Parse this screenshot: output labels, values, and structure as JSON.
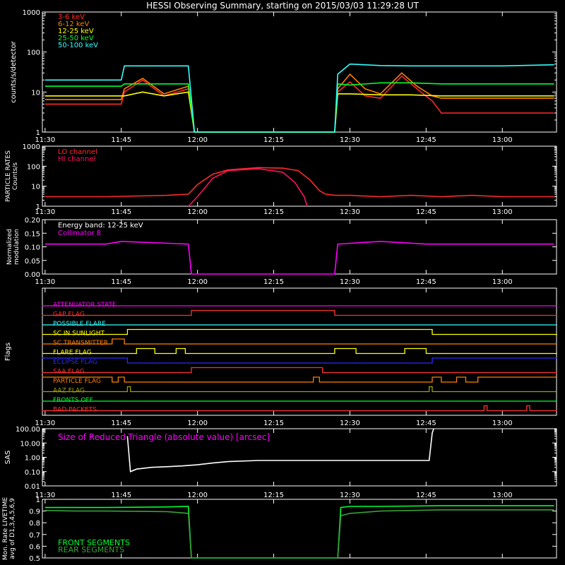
{
  "title": "HESSI Observing Summary, starting on 2015/03/03 11:29:28 UT",
  "time_ticks": [
    "11:30",
    "11:45",
    "12:00",
    "12:15",
    "12:30",
    "12:45",
    "13:00"
  ],
  "colors": {
    "bg": "#000000",
    "axis": "#ffffff",
    "red": "#ff2a2a",
    "orange": "#ff7f00",
    "yellow": "#ffff00",
    "green": "#00ff30",
    "cyan": "#33ffff",
    "magenta": "#ff00ff",
    "flag_red": "#ff3030",
    "flag_blue": "#2a2aff",
    "flag_olive": "#a0a000",
    "gray_green": "#3aa03a",
    "white": "#ffffff"
  },
  "chart_data": [
    {
      "id": "count-rates",
      "type": "line",
      "ylabel": "counts/s/detector",
      "yscale": "log",
      "ylim": [
        1,
        1000
      ],
      "yticks": [
        "1",
        "10",
        "100",
        "1000"
      ],
      "xlim": [
        11.4911,
        13.1778
      ],
      "series": [
        {
          "name": "3-6 keV",
          "color": "#ff2a2a",
          "x": [
            11.5,
            11.75,
            11.76,
            11.82,
            11.89,
            11.97,
            11.99,
            12.45,
            12.46,
            12.5,
            12.55,
            12.6,
            12.67,
            12.72,
            12.77,
            12.8,
            13.0,
            13.17
          ],
          "y": [
            5,
            5,
            10,
            20,
            8,
            12,
            1,
            1,
            10,
            18,
            8,
            7,
            25,
            12,
            6,
            3,
            3,
            3
          ]
        },
        {
          "name": "6-12 keV",
          "color": "#ff7f00",
          "x": [
            11.5,
            11.75,
            11.76,
            11.82,
            11.89,
            11.97,
            11.99,
            12.45,
            12.46,
            12.5,
            12.55,
            12.6,
            12.67,
            12.72,
            12.77,
            12.8,
            13.0,
            13.17
          ],
          "y": [
            6.5,
            6.5,
            12,
            22,
            9,
            14,
            1,
            1,
            12,
            28,
            12,
            9,
            30,
            14,
            8,
            7,
            7,
            7
          ]
        },
        {
          "name": "12-25 keV",
          "color": "#ffff00",
          "x": [
            11.5,
            11.75,
            11.76,
            11.82,
            11.89,
            11.97,
            11.99,
            12.45,
            12.46,
            12.5,
            12.6,
            12.7,
            12.8,
            13.0,
            13.17
          ],
          "y": [
            8,
            8,
            8,
            10,
            8,
            10,
            1,
            1,
            9,
            9,
            8.5,
            8.5,
            8,
            8,
            8
          ]
        },
        {
          "name": "25-50 keV",
          "color": "#00ff30",
          "x": [
            11.5,
            11.75,
            11.76,
            11.97,
            11.99,
            12.45,
            12.46,
            12.5,
            12.6,
            12.7,
            12.8,
            13.0,
            13.17
          ],
          "y": [
            14,
            14,
            16,
            16,
            1,
            1,
            16,
            15,
            17,
            17,
            16,
            16,
            16
          ]
        },
        {
          "name": "50-100 keV",
          "color": "#33ffff",
          "x": [
            11.5,
            11.75,
            11.76,
            11.97,
            11.99,
            12.45,
            12.46,
            12.5,
            12.6,
            12.7,
            12.8,
            13.0,
            13.17
          ],
          "y": [
            20,
            20,
            45,
            45,
            1,
            1,
            28,
            50,
            46,
            45,
            45,
            45,
            48
          ]
        }
      ]
    },
    {
      "id": "particle-rates",
      "type": "line",
      "ylabel": "PARTICLE RATES Counts/s",
      "yscale": "log",
      "ylim": [
        1,
        1000
      ],
      "yticks": [
        "1",
        "10",
        "100",
        "1000"
      ],
      "xlim": [
        11.4911,
        13.1778
      ],
      "series": [
        {
          "name": "LO channel",
          "color": "#ff2a2a",
          "x": [
            11.5,
            11.7,
            11.9,
            11.97,
            12.0,
            12.05,
            12.1,
            12.2,
            12.28,
            12.33,
            12.37,
            12.4,
            12.42,
            12.45,
            12.5,
            12.6,
            12.7,
            12.8,
            12.9,
            13.0,
            13.17
          ],
          "y": [
            3,
            3,
            3.5,
            4,
            12,
            40,
            65,
            85,
            80,
            60,
            20,
            6,
            4,
            3.5,
            3.5,
            3,
            3.5,
            3,
            3.5,
            3,
            3
          ]
        },
        {
          "name": "HI channel",
          "color": "#ff1060",
          "x": [
            11.97,
            12.0,
            12.05,
            12.1,
            12.2,
            12.28,
            12.32,
            12.35,
            12.36
          ],
          "y": [
            1,
            3,
            25,
            60,
            75,
            50,
            15,
            3,
            1
          ]
        }
      ]
    },
    {
      "id": "modulation",
      "type": "line",
      "ylabel": "Normalized modulation",
      "ylim": [
        0,
        0.2
      ],
      "yticks": [
        "0.00",
        "0.05",
        "0.10",
        "0.15",
        "0.20"
      ],
      "xlim": [
        11.4911,
        13.1778
      ],
      "annotation": "Energy band: 12-25 keV",
      "series": [
        {
          "name": "Collimator 8",
          "color": "#ff00ff",
          "x": [
            11.5,
            11.7,
            11.75,
            11.97,
            11.98,
            12.45,
            12.46,
            12.6,
            12.75,
            13.0,
            13.17
          ],
          "y": [
            0.11,
            0.11,
            0.12,
            0.11,
            0.0,
            0.0,
            0.11,
            0.12,
            0.11,
            0.11,
            0.11
          ]
        }
      ]
    },
    {
      "id": "flags",
      "type": "line",
      "ylabel": "Flags",
      "xlim": [
        11.4911,
        13.1778
      ],
      "flags": [
        {
          "name": "ATTENUATOR STATE",
          "color": "#ff00ff",
          "x": [
            11.49,
            13.18
          ],
          "y": [
            0,
            0
          ]
        },
        {
          "name": "GAP FLAG",
          "color": "#ff3030",
          "x": [
            11.49,
            11.98,
            11.98,
            12.45,
            12.45,
            13.18
          ],
          "y": [
            0,
            0,
            1,
            1,
            0,
            0
          ]
        },
        {
          "name": "POSSIBLE FLARE",
          "color": "#33ffff",
          "x": [
            11.49,
            13.18
          ],
          "y": [
            0,
            0
          ]
        },
        {
          "name": "SC IN SUNLIGHT",
          "color": "#ffff00",
          "x": [
            11.49,
            11.77,
            11.77,
            12.77,
            12.77,
            13.18
          ],
          "y": [
            0,
            0,
            1,
            1,
            0,
            0
          ]
        },
        {
          "name": "SC TRANSMITTER",
          "color": "#ff7f00",
          "x": [
            11.49,
            11.72,
            11.72,
            11.76,
            11.76,
            13.18
          ],
          "y": [
            0,
            0,
            1,
            1,
            0,
            0
          ]
        },
        {
          "name": "FLARE FLAG",
          "color": "#ffff00",
          "x": [
            11.49,
            11.8,
            11.8,
            11.86,
            11.86,
            11.93,
            11.93,
            11.96,
            11.96,
            12.45,
            12.45,
            12.52,
            12.52,
            12.68,
            12.68,
            12.75,
            12.75,
            13.18
          ],
          "y": [
            0,
            0,
            1,
            1,
            0,
            0,
            1,
            1,
            0,
            0,
            1,
            1,
            0,
            0,
            1,
            1,
            0,
            0
          ]
        },
        {
          "name": "ECLIPSE FLAG",
          "color": "#2a2aff",
          "x": [
            11.49,
            11.77,
            11.77,
            12.77,
            12.77,
            13.18
          ],
          "y": [
            1,
            1,
            0,
            0,
            1,
            1
          ]
        },
        {
          "name": "SAA FLAG",
          "color": "#ff3030",
          "x": [
            11.49,
            11.98,
            11.98,
            12.41,
            12.41,
            13.18
          ],
          "y": [
            0,
            0,
            1,
            1,
            0,
            0
          ]
        },
        {
          "name": "PARTICLE FLAG",
          "color": "#ff7f00",
          "x": [
            11.49,
            11.72,
            11.72,
            11.74,
            11.74,
            11.76,
            11.76,
            12.38,
            12.38,
            12.4,
            12.4,
            12.77,
            12.77,
            12.8,
            12.8,
            12.85,
            12.85,
            12.88,
            12.88,
            12.92,
            12.92,
            13.18
          ],
          "y": [
            1,
            1,
            0,
            0,
            1,
            1,
            0,
            0,
            1,
            1,
            0,
            0,
            1,
            1,
            0,
            0,
            1,
            1,
            0,
            0,
            1,
            1
          ]
        },
        {
          "name": "AAZ FLAG",
          "color": "#a0a000",
          "x": [
            11.49,
            11.77,
            11.77,
            11.78,
            11.78,
            12.76,
            12.76,
            12.77,
            12.77,
            13.18
          ],
          "y": [
            0,
            0,
            1,
            1,
            0,
            0,
            1,
            1,
            0,
            0
          ]
        },
        {
          "name": "FRONTS OFF",
          "color": "#00ff30",
          "x": [
            11.49,
            13.18
          ],
          "y": [
            0,
            0
          ]
        },
        {
          "name": "BAD PACKETS",
          "color": "#ff3030",
          "x": [
            11.49,
            12.94,
            12.94,
            12.95,
            12.95,
            13.08,
            13.08,
            13.09,
            13.09,
            13.18
          ],
          "y": [
            0,
            0,
            1,
            1,
            0,
            0,
            1,
            1,
            0,
            0
          ]
        }
      ]
    },
    {
      "id": "sas",
      "type": "line",
      "ylabel": "SAS",
      "yscale": "log",
      "ylim": [
        0.01,
        100
      ],
      "yticks": [
        "0.01",
        "0.10",
        "1.00",
        "10.00",
        "100.00"
      ],
      "xlim": [
        11.4911,
        13.1778
      ],
      "annotation": "Size of Reduced Triangle (absolute value) [arcsec]",
      "series": [
        {
          "name": "Size of Reduced Triangle (absolute value) [arcsec]",
          "color": "#ffffff",
          "x": [
            11.77,
            11.78,
            11.8,
            11.85,
            11.9,
            11.95,
            12.0,
            12.05,
            12.1,
            12.2,
            12.3,
            12.4,
            12.5,
            12.6,
            12.7,
            12.76,
            12.77,
            12.775
          ],
          "y": [
            30,
            0.1,
            0.15,
            0.2,
            0.22,
            0.25,
            0.3,
            0.4,
            0.5,
            0.6,
            0.6,
            0.6,
            0.6,
            0.6,
            0.6,
            0.6,
            50,
            100
          ]
        }
      ]
    },
    {
      "id": "livetime",
      "type": "line",
      "ylabel": "Mon. Rate LIVETIME avg of D1,3,4,5,6,9",
      "ylim": [
        0.5,
        1.0
      ],
      "yticks": [
        "0.5",
        "0.6",
        "0.7",
        "0.8",
        "0.9",
        "1"
      ],
      "xlim": [
        11.4911,
        13.1778
      ],
      "series": [
        {
          "name": "FRONT SEGMENTS",
          "color": "#00ff30",
          "x": [
            11.5,
            11.6,
            11.7,
            11.9,
            11.97,
            11.98,
            12.46,
            12.47,
            12.5,
            12.6,
            12.8,
            13.17
          ],
          "y": [
            0.93,
            0.93,
            0.93,
            0.935,
            0.94,
            0.5,
            0.5,
            0.93,
            0.94,
            0.94,
            0.945,
            0.945
          ]
        },
        {
          "name": "REAR SEGMENTS",
          "color": "#3aa03a",
          "x": [
            11.5,
            11.6,
            11.7,
            11.9,
            11.97,
            11.98,
            12.46,
            12.47,
            12.5,
            12.55,
            12.6,
            12.8,
            13.17
          ],
          "y": [
            0.905,
            0.9,
            0.9,
            0.895,
            0.88,
            0.5,
            0.5,
            0.86,
            0.88,
            0.89,
            0.9,
            0.91,
            0.91
          ]
        }
      ]
    }
  ]
}
